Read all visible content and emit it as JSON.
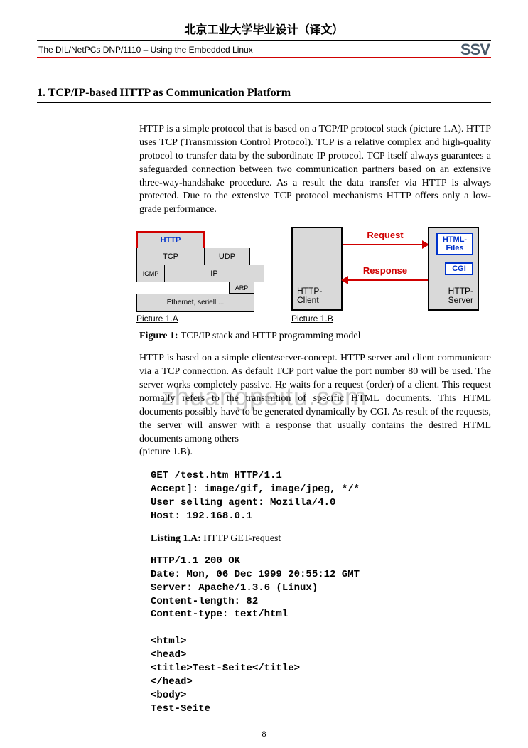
{
  "header": {
    "title_cn": "北京工业大学毕业设计（译文）",
    "subtitle": "The DIL/NetPCs DNP/1110 – Using the Embedded Linux",
    "logo_text": "SSV"
  },
  "section": {
    "heading": "1. TCP/IP-based HTTP as Communication Platform",
    "para1": "HTTP is a simple protocol that is based on a TCP/IP protocol stack (picture 1.A). HTTP uses TCP (Transmission Control Protocol). TCP is a relative complex and high-quality protocol to transfer data by the subordinate IP protocol. TCP itself always guarantees a safeguarded connection between two communication partners based on an extensive three-way-handshake procedure. As a result the data transfer via HTTP is always protected. Due to the extensive TCP protocol mechanisms HTTP offers only a low-grade performance.",
    "para2": "HTTP is based on a simple client/server-concept. HTTP server and client communicate via a TCP connection. As default TCP port value the port number 80 will be used. The server works completely passive. He waits for a request (order) of a client. This request normally refers to the transmition of specific HTML documents. This HTML documents possibly have to be generated dynamically by CGI. As result of the requests, the server will answer with a response that usually contains the desired HTML documents among others",
    "para2_tail": "(picture 1.B)."
  },
  "figure1": {
    "stack": {
      "http": "HTTP",
      "tcp": "TCP",
      "udp": "UDP",
      "icmp": "ICMP",
      "ip": "IP",
      "arp": "ARP",
      "eth": "Ethernet, seriell ...",
      "label": "Picture 1.A"
    },
    "cs": {
      "client": "HTTP-\nClient",
      "server": "HTTP-\nServer",
      "html_files": "HTML-\nFiles",
      "cgi": "CGI",
      "request": "Request",
      "response": "Response",
      "label": "Picture 1.B"
    },
    "caption_bold": "Figure 1:",
    "caption_rest": " TCP/IP stack and HTTP programming model"
  },
  "watermark": "zhuangpeitu.com",
  "listing_a": {
    "code": "GET /test.htm HTTP/1.1\nAccept]: image/gif, image/jpeg, */*\nUser selling agent: Mozilla/4.0\nHost: 192.168.0.1",
    "label_bold": "Listing 1.A:",
    "label_rest": " HTTP GET-request"
  },
  "listing_b": {
    "code": "HTTP/1.1 200 OK\nDate: Mon, 06 Dec 1999 20:55:12 GMT\nServer: Apache/1.3.6 (Linux)\nContent-length: 82\nContent-type: text/html\n\n<html>\n<head>\n<title>Test-Seite</title>\n</head>\n<body>\nTest-Seite"
  },
  "page_number": "8"
}
